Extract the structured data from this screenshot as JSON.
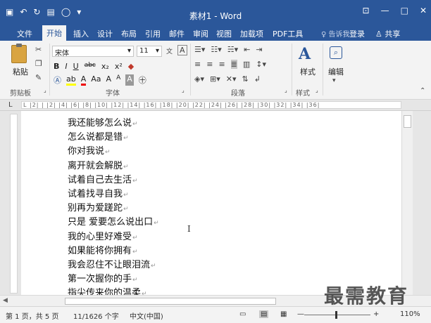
{
  "window": {
    "title": "素材1 - Word",
    "qat": {
      "save_icon": "save-icon",
      "undo_icon": "undo-icon",
      "redo_icon": "redo-icon",
      "print_preview_icon": "print-preview-icon",
      "circle_icon": "circle-icon",
      "more_icon": "customize-qat-icon"
    },
    "controls": {
      "restore": "⊡",
      "minimize": "—",
      "maximize": "□",
      "close": "✕"
    }
  },
  "tabs": [
    {
      "label": "文件"
    },
    {
      "label": "开始",
      "active": true
    },
    {
      "label": "插入"
    },
    {
      "label": "设计"
    },
    {
      "label": "布局"
    },
    {
      "label": "引用"
    },
    {
      "label": "邮件"
    },
    {
      "label": "审阅"
    },
    {
      "label": "视图"
    },
    {
      "label": "加载项"
    },
    {
      "label": "PDF工具"
    }
  ],
  "tell_me": "告诉我",
  "login": "登录",
  "share": "共享",
  "ribbon": {
    "clipboard": {
      "paste": "粘贴",
      "group_label": "剪贴板"
    },
    "font": {
      "font_name": "宋体",
      "font_size": "11",
      "bold": "B",
      "italic": "I",
      "underline": "U",
      "strike": "abc",
      "subscript": "x₂",
      "superscript": "x²",
      "change_case": "Aa",
      "grow": "A",
      "shrink": "A",
      "group_label": "字体"
    },
    "paragraph": {
      "group_label": "段落"
    },
    "styles": {
      "label": "样式",
      "group_label": "样式"
    },
    "editing": {
      "label": "编辑"
    }
  },
  "ruler": {
    "marks": "L  |2|  |  |2|  |4|  |6|  |8|  |10|  |12|  |14|  |16|  |18|  |20|  |22|  |24|  |26|  |28|  |30|  |32|  |34|  |36|"
  },
  "document": {
    "lines": [
      "我还能够怎么说",
      "怎么说都是错",
      "你对我说",
      "离开就会解脱",
      "试着自己去生活",
      "试着找寻自我",
      "别再为爱蹉跎",
      "只是  爱要怎么说出口",
      "我的心里好难受",
      "如果能将你拥有",
      "我会忍住不让眼泪流",
      "第一次握你的手",
      "指尖传来你的温柔"
    ],
    "para_mark": "↵"
  },
  "status": {
    "page": "第 1 页，共 5 页",
    "words": "11/1626 个字",
    "language": "中文(中国)",
    "zoom": "110%"
  },
  "watermark": "最需教育"
}
